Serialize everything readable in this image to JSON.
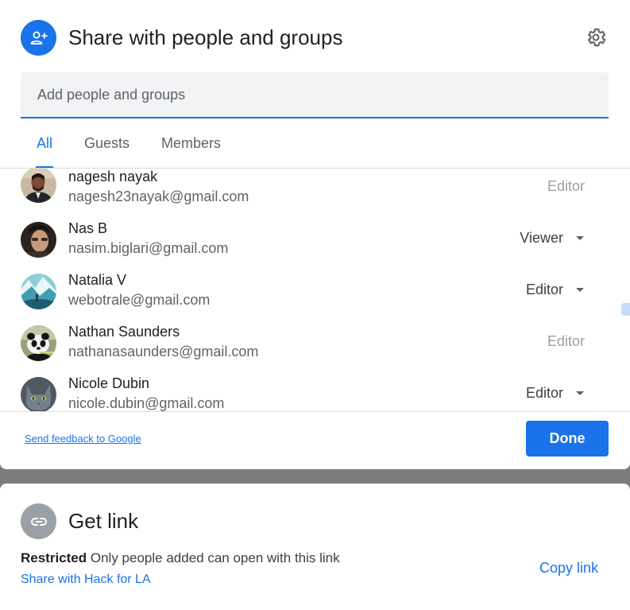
{
  "share_dialog": {
    "title": "Share with people and groups",
    "add_placeholder": "Add people and groups",
    "tabs": [
      {
        "label": "All",
        "active": true
      },
      {
        "label": "Guests",
        "active": false
      },
      {
        "label": "Members",
        "active": false
      }
    ],
    "people": [
      {
        "name": "nagesh nayak",
        "email": "nagesh23nayak@gmail.com",
        "role": "Editor",
        "role_editable": false
      },
      {
        "name": "Nas B",
        "email": "nasim.biglari@gmail.com",
        "role": "Viewer",
        "role_editable": true
      },
      {
        "name": "Natalia V",
        "email": "webotrale@gmail.com",
        "role": "Editor",
        "role_editable": true
      },
      {
        "name": "Nathan Saunders",
        "email": "nathanasaunders@gmail.com",
        "role": "Editor",
        "role_editable": false
      },
      {
        "name": "Nicole Dubin",
        "email": "nicole.dubin@gmail.com",
        "role": "Editor",
        "role_editable": true
      }
    ],
    "feedback_link": "Send feedback to Google",
    "done_label": "Done"
  },
  "get_link": {
    "title": "Get link",
    "restriction_label": "Restricted",
    "restriction_desc": "Only people added can open with this link",
    "share_org_link": "Share with Hack for LA",
    "copy_link_label": "Copy link"
  },
  "colors": {
    "accent": "#1a73e8",
    "link_icon_bg": "#9aa0a6",
    "backdrop": "#7c7c7c"
  },
  "icons": {
    "title_icon": "person-add-icon",
    "settings": "gear-icon",
    "link_icon": "link-icon",
    "role_caret": "caret-down-icon"
  }
}
